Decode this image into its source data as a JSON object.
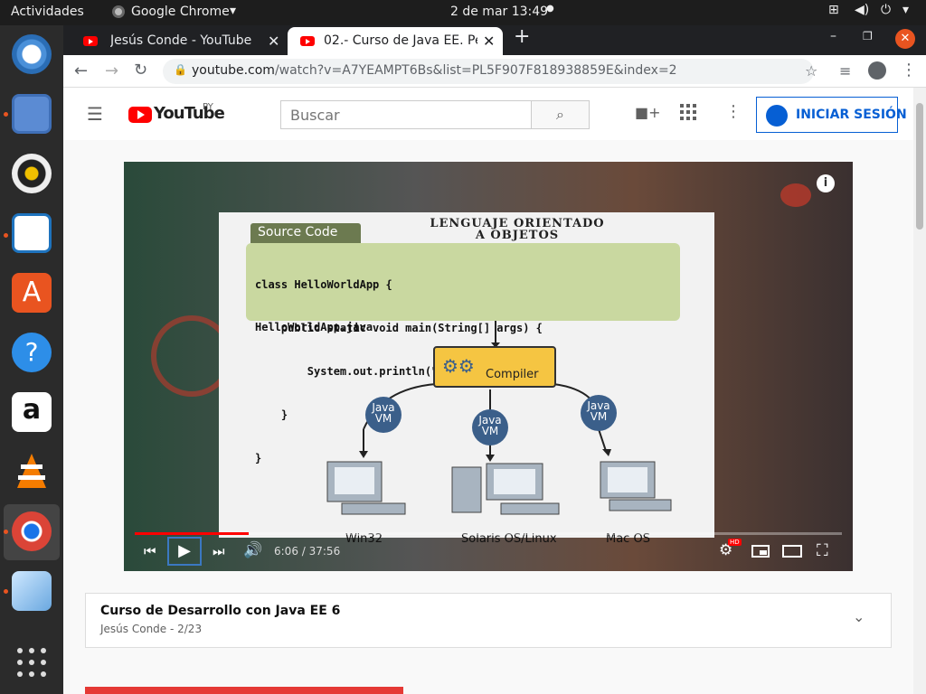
{
  "system_bar": {
    "activities": "Actividades",
    "app_name": "Google Chrome",
    "clock": "2 de mar  13:49"
  },
  "tabs": [
    {
      "title": "Jesús Conde - YouTube",
      "active": false
    },
    {
      "title": "02.- Curso de Java EE. Per",
      "active": true
    }
  ],
  "address_bar": {
    "domain": "youtube.com",
    "path": "/watch?v=A7YEAMPT6Bs&list=PL5F907F818938859E&index=2"
  },
  "youtube": {
    "logo_text": "YouTube",
    "country_code": "PY",
    "search_placeholder": "Buscar",
    "signin_label": "INICIAR SESIÓN",
    "brand_color": "#ff0000",
    "accent_color": "#065fd4"
  },
  "slide": {
    "title_line1": "LENGUAJE ORIENTADO",
    "title_line2": "A OBJETOS",
    "source_tab": "Source Code",
    "code_lines": [
      "class HelloWorldApp {",
      "    public static void main(String[] args) {",
      "        System.out.println(\"Hello World!\");",
      "    }",
      "}"
    ],
    "filename": "HelloWorldApp.java",
    "compiler_label": "Compiler",
    "vm_label_line1": "Java",
    "vm_label_line2": "VM",
    "platforms": [
      "Win32",
      "Solaris OS/Linux",
      "Mac OS"
    ]
  },
  "player": {
    "time": "6:06 / 37:56",
    "progress": 0.161,
    "hd_badge": "HD"
  },
  "playlist": {
    "title": "Curso de Desarrollo con Java EE 6",
    "meta": "Jesús Conde - 2/23"
  }
}
